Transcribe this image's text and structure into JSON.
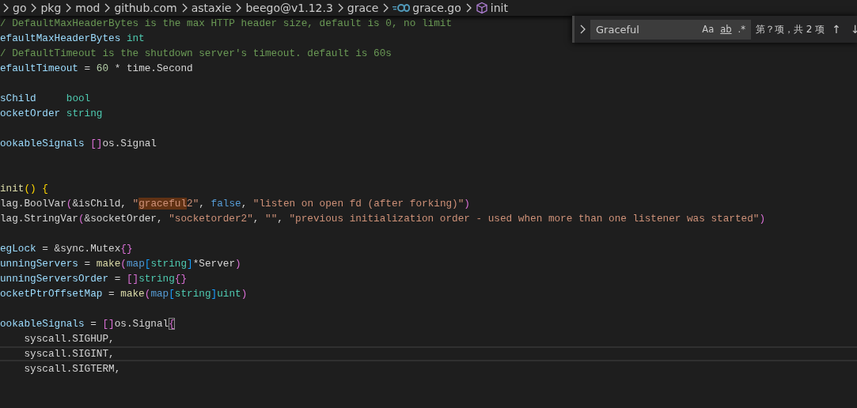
{
  "breadcrumb": [
    {
      "label": "go",
      "kind": "folder"
    },
    {
      "label": "pkg",
      "kind": "folder"
    },
    {
      "label": "mod",
      "kind": "folder"
    },
    {
      "label": "github.com",
      "kind": "folder"
    },
    {
      "label": "astaxie",
      "kind": "folder"
    },
    {
      "label": "beego@v1.12.3",
      "kind": "folder"
    },
    {
      "label": "grace",
      "kind": "folder"
    },
    {
      "label": "grace.go",
      "kind": "file"
    },
    {
      "label": "init",
      "kind": "symbol"
    }
  ],
  "find": {
    "value": "Graceful",
    "options": [
      {
        "label": "Aa",
        "selected": false
      },
      {
        "label": "ab",
        "selected": false
      },
      {
        "label": ".*",
        "selected": false
      }
    ],
    "result": "第？项，共 2 项",
    "nav": [
      "↑",
      "↓"
    ]
  },
  "lines": [
    {
      "kind": "code",
      "current": false,
      "tokens": [
        {
          "kind": "comment",
          "text": "/ DefaultMaxHeaderBytes is the max HTTP header size, default is 0, no limit"
        }
      ]
    },
    {
      "kind": "code",
      "current": false,
      "tokens": [
        {
          "kind": "var",
          "text": "efaultMaxHeaderBytes "
        },
        {
          "kind": "type",
          "text": "int"
        }
      ]
    },
    {
      "kind": "code",
      "current": false,
      "tokens": [
        {
          "kind": "comment",
          "text": "/ DefaultTimeout is the shutdown server's timeout. default is 60s"
        }
      ]
    },
    {
      "kind": "code",
      "current": false,
      "tokens": [
        {
          "kind": "var",
          "text": "efaultTimeout"
        },
        {
          "kind": "plain",
          "text": " = "
        },
        {
          "kind": "number",
          "text": "60"
        },
        {
          "kind": "plain",
          "text": " * time.Second"
        }
      ]
    },
    {
      "kind": "blank"
    },
    {
      "kind": "code",
      "current": false,
      "tokens": [
        {
          "kind": "var",
          "text": "sChild     "
        },
        {
          "kind": "type",
          "text": "bool"
        }
      ]
    },
    {
      "kind": "code",
      "current": false,
      "tokens": [
        {
          "kind": "var",
          "text": "ocketOrder "
        },
        {
          "kind": "type",
          "text": "string"
        }
      ]
    },
    {
      "kind": "blank"
    },
    {
      "kind": "code",
      "current": false,
      "tokens": [
        {
          "kind": "var",
          "text": "ookableSignals "
        },
        {
          "kind": "bracket2",
          "text": "[]"
        },
        {
          "kind": "plain",
          "text": "os.Signal"
        }
      ]
    },
    {
      "kind": "blank"
    },
    {
      "kind": "blank"
    },
    {
      "kind": "code",
      "current": false,
      "tokens": [
        {
          "kind": "func",
          "text": "init"
        },
        {
          "kind": "bracket1",
          "text": "() {"
        }
      ]
    },
    {
      "kind": "code",
      "current": false,
      "tokens": [
        {
          "kind": "plain",
          "text": "lag.BoolVar"
        },
        {
          "kind": "bracket2",
          "text": "("
        },
        {
          "kind": "plain",
          "text": "&isChild, "
        },
        {
          "kind": "string",
          "text": "\""
        },
        {
          "kind": "match",
          "text": "graceful"
        },
        {
          "kind": "string",
          "text": "2\""
        },
        {
          "kind": "plain",
          "text": ", "
        },
        {
          "kind": "keyword",
          "text": "false"
        },
        {
          "kind": "plain",
          "text": ", "
        },
        {
          "kind": "string",
          "text": "\"listen on open fd (after forking)\""
        },
        {
          "kind": "bracket2",
          "text": ")"
        }
      ]
    },
    {
      "kind": "code",
      "current": false,
      "tokens": [
        {
          "kind": "plain",
          "text": "lag.StringVar"
        },
        {
          "kind": "bracket2",
          "text": "("
        },
        {
          "kind": "plain",
          "text": "&socketOrder, "
        },
        {
          "kind": "string",
          "text": "\"socketorder2\""
        },
        {
          "kind": "plain",
          "text": ", "
        },
        {
          "kind": "string",
          "text": "\"\""
        },
        {
          "kind": "plain",
          "text": ", "
        },
        {
          "kind": "string",
          "text": "\"previous initialization order - used when more than one listener was started\""
        },
        {
          "kind": "bracket2",
          "text": ")"
        }
      ]
    },
    {
      "kind": "blank"
    },
    {
      "kind": "code",
      "current": false,
      "tokens": [
        {
          "kind": "var",
          "text": "egLock"
        },
        {
          "kind": "plain",
          "text": " = &sync.Mutex"
        },
        {
          "kind": "bracket2",
          "text": "{}"
        }
      ]
    },
    {
      "kind": "code",
      "current": false,
      "tokens": [
        {
          "kind": "var",
          "text": "unningServers"
        },
        {
          "kind": "plain",
          "text": " = "
        },
        {
          "kind": "func",
          "text": "make"
        },
        {
          "kind": "bracket2",
          "text": "("
        },
        {
          "kind": "keyword",
          "text": "map"
        },
        {
          "kind": "bracket3",
          "text": "["
        },
        {
          "kind": "type",
          "text": "string"
        },
        {
          "kind": "bracket3",
          "text": "]"
        },
        {
          "kind": "plain",
          "text": "*Server"
        },
        {
          "kind": "bracket2",
          "text": ")"
        }
      ]
    },
    {
      "kind": "code",
      "current": false,
      "tokens": [
        {
          "kind": "var",
          "text": "unningServersOrder"
        },
        {
          "kind": "plain",
          "text": " = "
        },
        {
          "kind": "bracket2",
          "text": "[]"
        },
        {
          "kind": "type",
          "text": "string"
        },
        {
          "kind": "bracket2",
          "text": "{}"
        }
      ]
    },
    {
      "kind": "code",
      "current": false,
      "tokens": [
        {
          "kind": "var",
          "text": "ocketPtrOffsetMap"
        },
        {
          "kind": "plain",
          "text": " = "
        },
        {
          "kind": "func",
          "text": "make"
        },
        {
          "kind": "bracket2",
          "text": "("
        },
        {
          "kind": "keyword",
          "text": "map"
        },
        {
          "kind": "bracket3",
          "text": "["
        },
        {
          "kind": "type",
          "text": "string"
        },
        {
          "kind": "bracket3",
          "text": "]"
        },
        {
          "kind": "type",
          "text": "uint"
        },
        {
          "kind": "bracket2",
          "text": ")"
        }
      ]
    },
    {
      "kind": "blank"
    },
    {
      "kind": "code",
      "current": false,
      "tokens": [
        {
          "kind": "var",
          "text": "ookableSignals"
        },
        {
          "kind": "plain",
          "text": " = "
        },
        {
          "kind": "bracket2",
          "text": "[]"
        },
        {
          "kind": "plain",
          "text": "os.Signal"
        },
        {
          "kind": "bracket-match",
          "text": "{"
        }
      ]
    },
    {
      "kind": "code",
      "current": false,
      "tokens": [
        {
          "kind": "plain",
          "text": "    syscall.SIGHUP,"
        }
      ]
    },
    {
      "kind": "code",
      "current": true,
      "tokens": [
        {
          "kind": "plain",
          "text": "    syscall.SIGINT,"
        }
      ]
    },
    {
      "kind": "code",
      "current": false,
      "tokens": [
        {
          "kind": "plain",
          "text": "    syscall.SIGTERM,"
        }
      ]
    }
  ]
}
